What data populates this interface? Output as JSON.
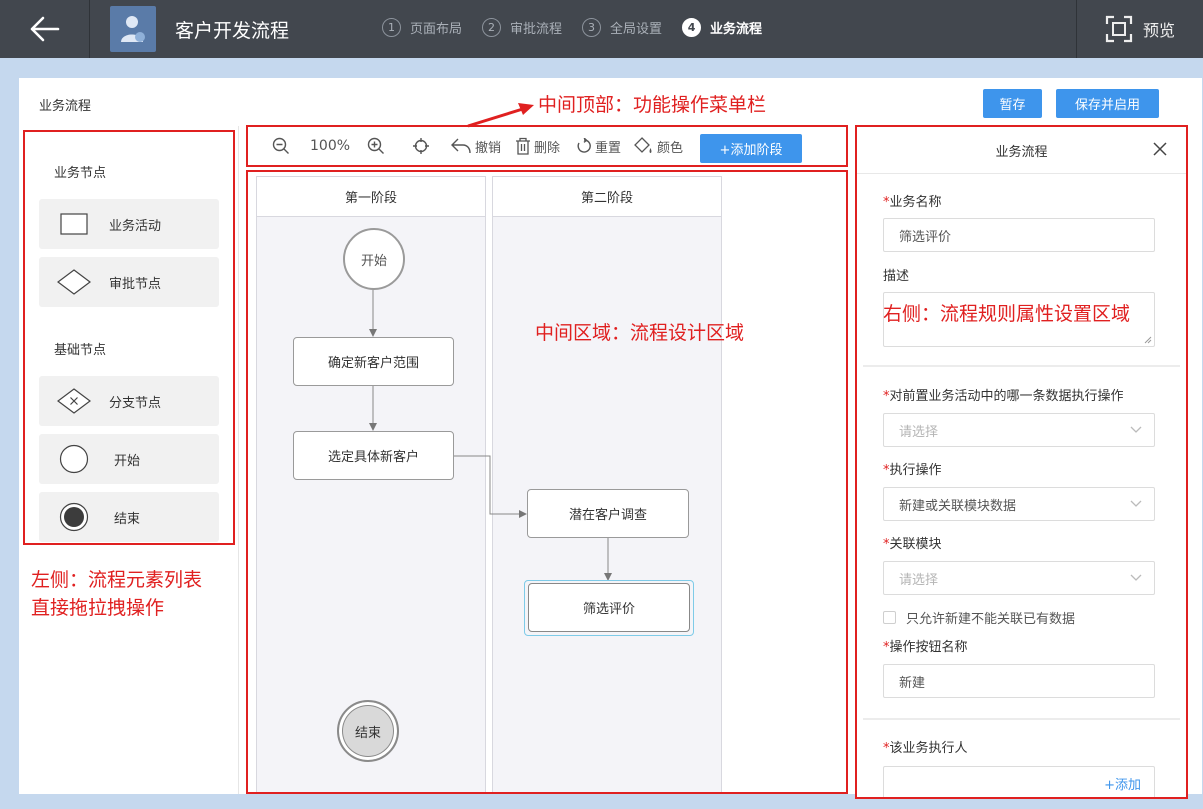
{
  "header": {
    "title": "客户开发流程",
    "steps": [
      {
        "num": "1",
        "label": "页面布局"
      },
      {
        "num": "2",
        "label": "审批流程"
      },
      {
        "num": "3",
        "label": "全局设置"
      },
      {
        "num": "4",
        "label": "业务流程"
      }
    ],
    "preview_label": "预览"
  },
  "page": {
    "title": "业务流程",
    "save_draft_label": "暂存",
    "save_enable_label": "保存并启用"
  },
  "left": {
    "business_nodes_title": "业务节点",
    "basic_nodes_title": "基础节点",
    "items": {
      "activity": "业务活动",
      "approval": "审批节点",
      "branch": "分支节点",
      "start": "开始",
      "end": "结束"
    }
  },
  "toolbar": {
    "zoom": "100%",
    "undo": "撤销",
    "delete": "删除",
    "reset": "重置",
    "color": "颜色",
    "add_stage": "+添加阶段"
  },
  "canvas": {
    "lanes": [
      "第一阶段",
      "第二阶段"
    ],
    "start": "开始",
    "end": "结束",
    "nodes": [
      "确定新客户范围",
      "选定具体新客户",
      "潜在客户调查",
      "筛选评价"
    ]
  },
  "right": {
    "title": "业务流程",
    "name_label": "业务名称",
    "name_value": "筛选评价",
    "desc_label": "描述",
    "data_row_label": "对前置业务活动中的哪一条数据执行操作",
    "data_row_placeholder": "请选择",
    "action_label": "执行操作",
    "action_value": "新建或关联模块数据",
    "module_label": "关联模块",
    "module_placeholder": "请选择",
    "checkbox_label": "只允许新建不能关联已有数据",
    "button_name_label": "操作按钮名称",
    "button_name_value": "新建",
    "executor_label": "该业务执行人",
    "add_label": "+添加"
  },
  "annotations": {
    "top": "中间顶部：功能操作菜单栏",
    "middle": "中间区域：流程设计区域",
    "right": "右侧：流程规则属性设置区域",
    "left_line1": "左侧：流程元素列表",
    "left_line2": "直接拖拉拽操作"
  },
  "colors": {
    "header_bg": "#42474e",
    "accent": "#3e95ec",
    "annotation": "#e02020",
    "page_bg": "#c5d8ee"
  }
}
